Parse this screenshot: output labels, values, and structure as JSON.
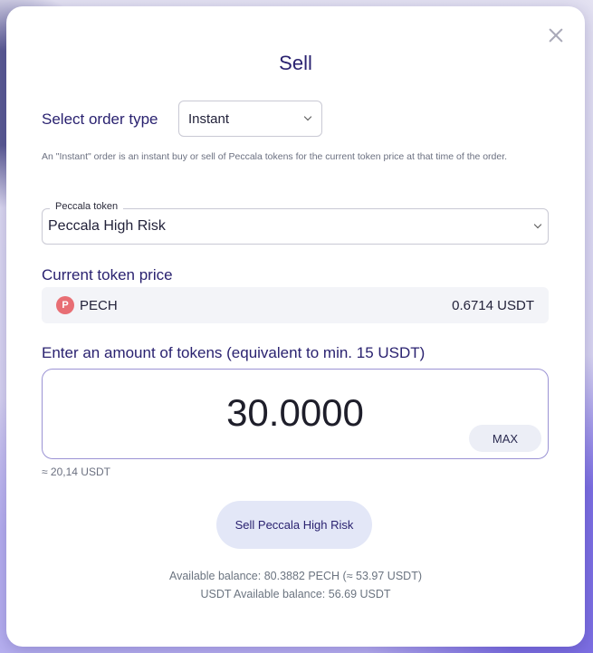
{
  "modal": {
    "title": "Sell",
    "close_icon": "close-icon"
  },
  "order_type": {
    "label": "Select order type",
    "selected": "Instant",
    "description": "An \"Instant\" order is an instant buy or sell of Peccala tokens for the current token price at that time of the order."
  },
  "token_select": {
    "legend": "Peccala token",
    "selected": "Peccala High Risk"
  },
  "price": {
    "label": "Current token price",
    "icon_glyph": "P",
    "symbol": "PECH",
    "value": "0.6714 USDT"
  },
  "amount": {
    "label": "Enter an amount of tokens (equivalent to min. 15 USDT)",
    "value": "30.0000",
    "max_label": "MAX",
    "approx": "≈ 20,14 USDT"
  },
  "sell_button": "Sell Peccala High Risk",
  "balances": {
    "available": "Available balance:  80.3882 PECH (≈ 53.97 USDT)",
    "usdt_available": "USDT Available balance: 56.69 USDT"
  },
  "colors": {
    "title": "#2a2270",
    "amount_border": "#9b93d4",
    "pech_icon": "#e86e74",
    "sell_button_bg": "#e3e7f7"
  }
}
